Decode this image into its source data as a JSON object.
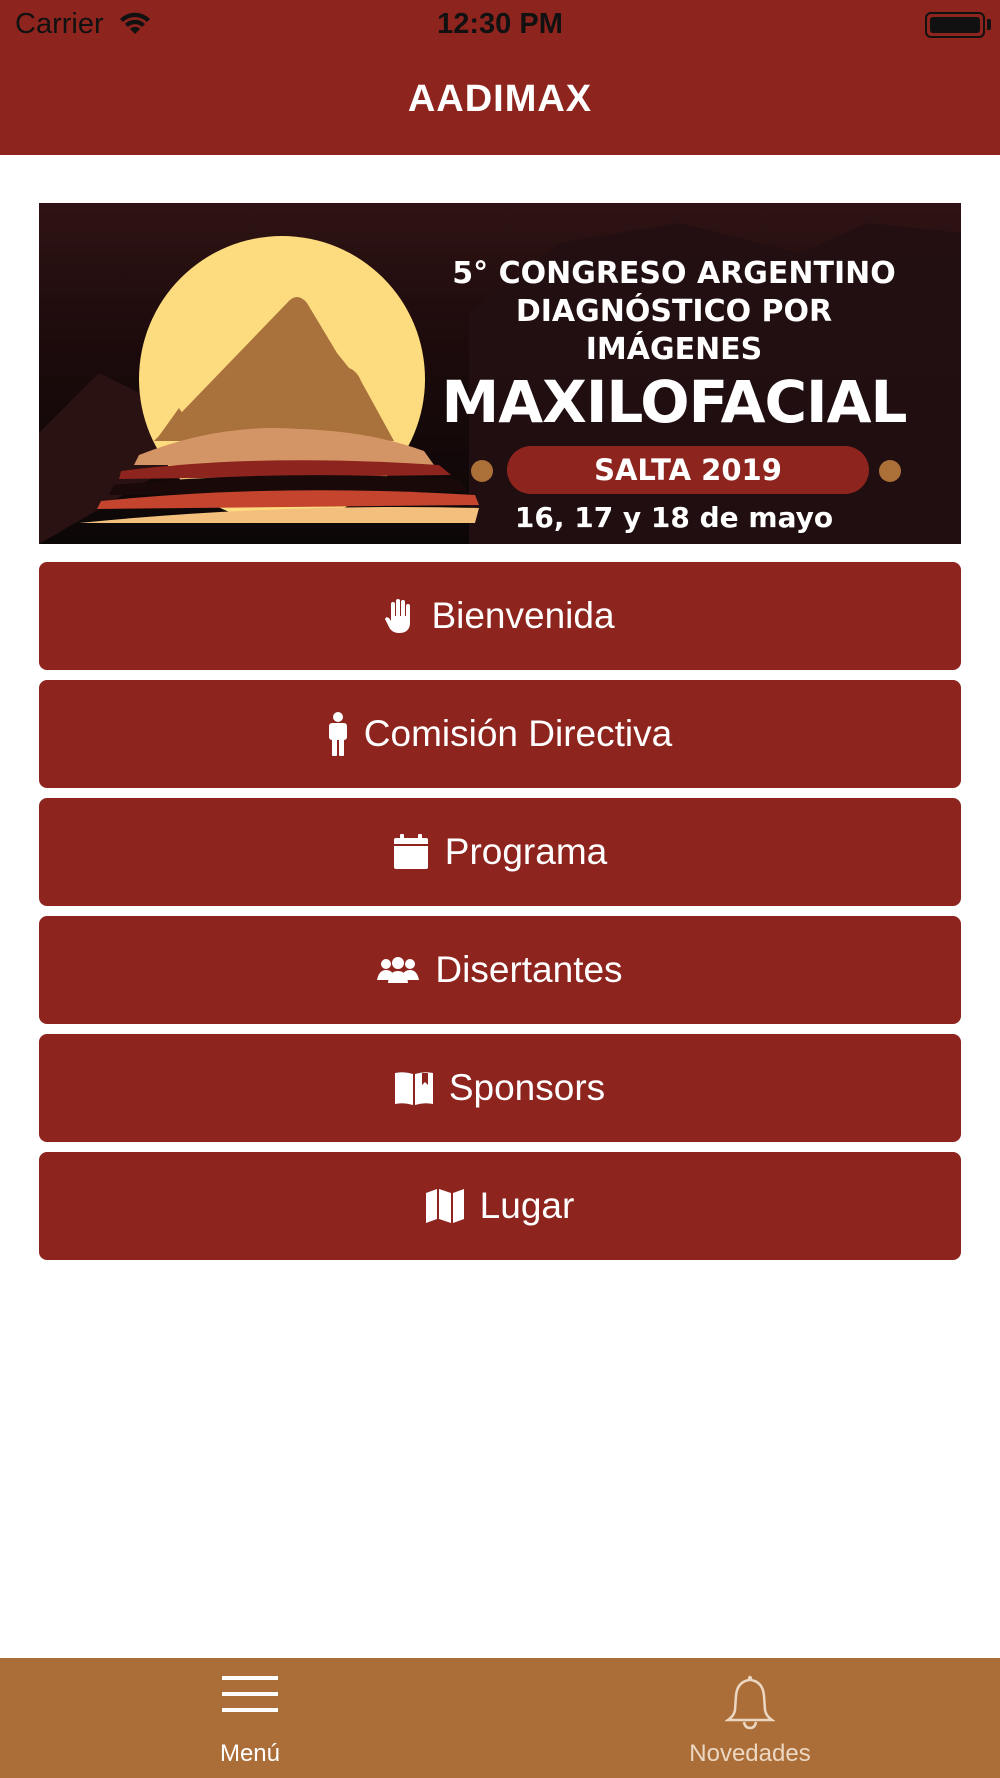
{
  "status_bar": {
    "carrier": "Carrier",
    "time": "12:30 PM"
  },
  "header": {
    "title": "AADIMAX"
  },
  "banner": {
    "line1": "5° CONGRESO ARGENTINO",
    "line2": "DIAGNÓSTICO POR IMÁGENES",
    "line3": "MAXILOFACIAL",
    "place": "SALTA 2019",
    "dates": "16, 17 y 18 de mayo"
  },
  "menu": {
    "items": [
      {
        "label": "Bienvenida",
        "icon": "hand-icon"
      },
      {
        "label": "Comisión Directiva",
        "icon": "person-icon"
      },
      {
        "label": "Programa",
        "icon": "calendar-icon"
      },
      {
        "label": "Disertantes",
        "icon": "group-icon"
      },
      {
        "label": "Sponsors",
        "icon": "book-icon"
      },
      {
        "label": "Lugar",
        "icon": "map-icon"
      }
    ]
  },
  "tabbar": {
    "tabs": [
      {
        "label": "Menú",
        "icon": "hamburger-icon",
        "active": true
      },
      {
        "label": "Novedades",
        "icon": "bell-icon",
        "active": false
      }
    ]
  },
  "colors": {
    "primary": "#8e241e",
    "tabbar": "#ab6e38",
    "sun": "#fddb7f"
  }
}
